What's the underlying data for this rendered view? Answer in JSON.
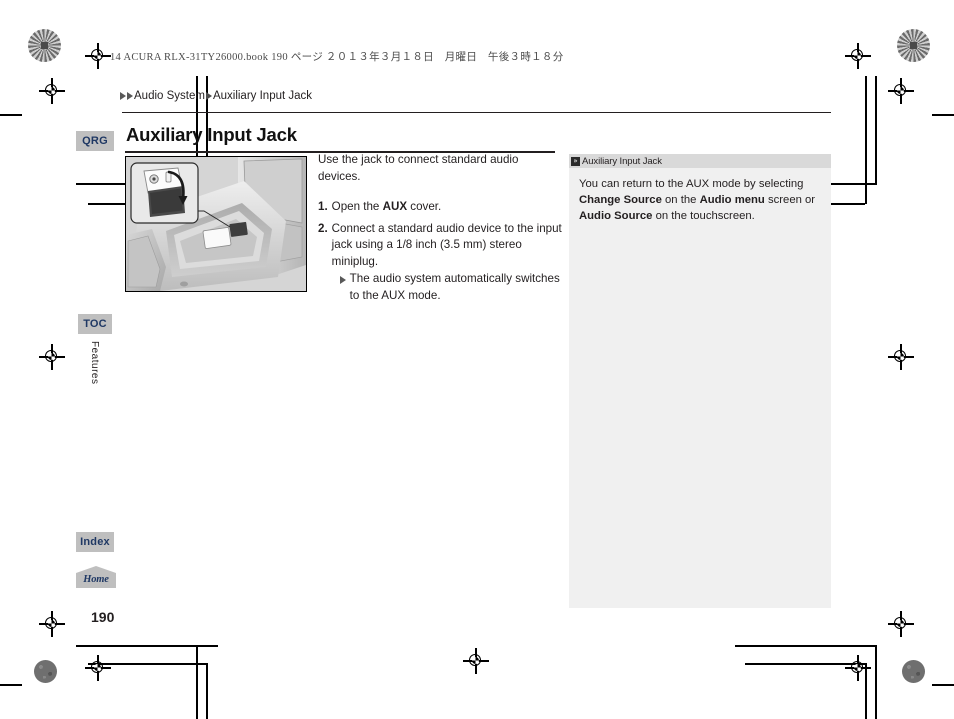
{
  "print_header": "14 ACURA RLX-31TY26000.book   190 ページ   ２０１３年３月１８日　月曜日　午後３時１８分",
  "breadcrumb": {
    "name": "breadcrumb",
    "items": [
      "Audio System",
      "Auxiliary Input Jack"
    ]
  },
  "page_title": "Auxiliary Input Jack",
  "nav_tabs": {
    "qrg": "QRG",
    "toc": "TOC",
    "section_label": "Features",
    "index": "Index",
    "home": "Home"
  },
  "page_number": "190",
  "body": {
    "intro": "Use the jack to connect standard audio devices.",
    "steps": [
      {
        "num": "1.",
        "parts": [
          {
            "text": "Open the ",
            "bold": false
          },
          {
            "text": "AUX",
            "bold": true
          },
          {
            "text": " cover.",
            "bold": false
          }
        ]
      },
      {
        "num": "2.",
        "parts": [
          {
            "text": "Connect a standard audio device to the input jack using a 1/8 inch (3.5 mm) stereo miniplug.",
            "bold": false
          }
        ],
        "sub_note": "The audio system automatically switches to the AUX mode."
      }
    ]
  },
  "side_panel": {
    "glyph": "»",
    "title": "Auxiliary Input Jack",
    "parts": [
      {
        "text": "You can return to the AUX mode by selecting ",
        "bold": false
      },
      {
        "text": "Change Source",
        "bold": true
      },
      {
        "text": " on the ",
        "bold": false
      },
      {
        "text": "Audio menu",
        "bold": true
      },
      {
        "text": " screen or ",
        "bold": false
      },
      {
        "text": "Audio Source",
        "bold": true
      },
      {
        "text": " on the touchscreen.",
        "bold": false
      }
    ]
  },
  "figure": {
    "caption": "Center console auxiliary input jack with magnified inset of AUX cover"
  },
  "colors": {
    "tab_bg": "#bfbfbf",
    "tab_text": "#1f3864",
    "panel_bg": "#f0f0f0",
    "panel_head_bg": "#d9d9d9",
    "text": "#231f20"
  }
}
